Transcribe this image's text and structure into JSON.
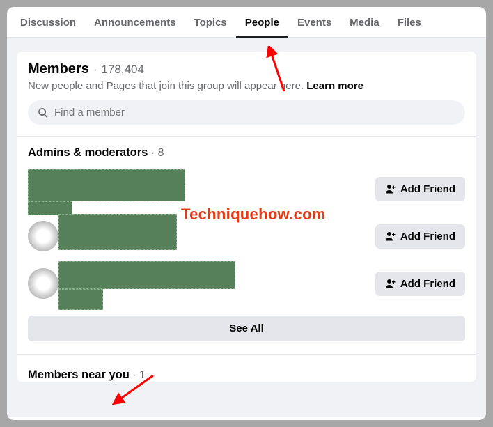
{
  "tabs": [
    {
      "label": "Discussion",
      "active": false
    },
    {
      "label": "Announcements",
      "active": false
    },
    {
      "label": "Topics",
      "active": false
    },
    {
      "label": "People",
      "active": true
    },
    {
      "label": "Events",
      "active": false
    },
    {
      "label": "Media",
      "active": false
    },
    {
      "label": "Files",
      "active": false
    }
  ],
  "members_header": {
    "title": "Members",
    "separator": "·",
    "count": "178,404",
    "subtitle": "New people and Pages that join this group will appear here.",
    "learn_more": "Learn more"
  },
  "search": {
    "placeholder": "Find a member"
  },
  "admins": {
    "title": "Admins & moderators",
    "separator": "·",
    "count": "8",
    "add_friend_label": "Add Friend",
    "see_all_label": "See All"
  },
  "near_you": {
    "title": "Members near you",
    "separator": "·",
    "count": "1"
  },
  "watermark": "Techniquehow.com"
}
